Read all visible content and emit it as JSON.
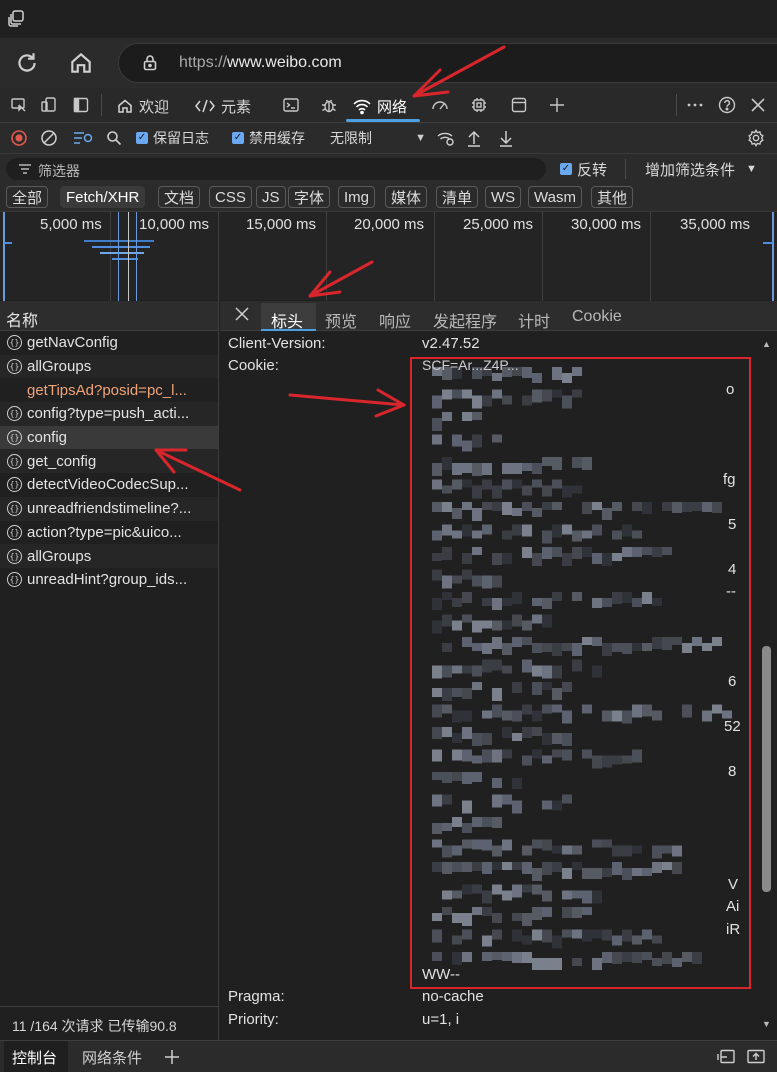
{
  "browser": {
    "url_scheme": "https://",
    "url_host": "www.weibo.com"
  },
  "devtools_tabs": [
    {
      "label": "欢迎"
    },
    {
      "label": "元素"
    },
    {
      "label": "网络"
    }
  ],
  "toolbar": {
    "preserve_log": "保留日志",
    "disable_cache": "禁用缓存",
    "throttling": "无限制"
  },
  "filter": {
    "placeholder": "筛选器",
    "invert": "反转",
    "more_filters": "增加筛选条件"
  },
  "type_filters": [
    "全部",
    "Fetch/XHR",
    "文档",
    "CSS",
    "JS",
    "字体",
    "Img",
    "媒体",
    "清单",
    "WS",
    "Wasm",
    "其他"
  ],
  "timeline_ticks": [
    "5,000 ms",
    "10,000 ms",
    "15,000 ms",
    "20,000 ms",
    "25,000 ms",
    "30,000 ms",
    "35,000 ms"
  ],
  "request_list": {
    "header": "名称",
    "rows": [
      {
        "name": "getNavConfig",
        "type": "xhr"
      },
      {
        "name": "allGroups",
        "type": "xhr"
      },
      {
        "name": "getTipsAd?posid=pc_l...",
        "type": "pending"
      },
      {
        "name": "config?type=push_acti...",
        "type": "xhr"
      },
      {
        "name": "config",
        "type": "xhr"
      },
      {
        "name": "get_config",
        "type": "xhr"
      },
      {
        "name": "detectVideoCodecSup...",
        "type": "xhr"
      },
      {
        "name": "unreadfriendstimeline?...",
        "type": "xhr"
      },
      {
        "name": "action?type=pic&uico...",
        "type": "xhr"
      },
      {
        "name": "allGroups",
        "type": "xhr"
      },
      {
        "name": "unreadHint?group_ids...",
        "type": "xhr"
      }
    ],
    "status": "11 /164 次请求  已传输90.8"
  },
  "detail": {
    "tabs": [
      "标头",
      "预览",
      "响应",
      "发起程序",
      "计时",
      "Cookie"
    ],
    "headers": {
      "client_version_key": "Client-Version:",
      "client_version_val": "v2.47.52",
      "cookie_key": "Cookie:",
      "pragma_key": "Pragma:",
      "pragma_val": "no-cache",
      "priority_key": "Priority:",
      "priority_val": "u=1, i"
    },
    "cookie_visible_fragments": [
      "SCF=Ar...Z4P...",
      "o",
      "fg",
      "5",
      "4",
      "--",
      "6",
      "52",
      "8",
      "V",
      "Ai",
      "iR",
      "WW--"
    ]
  },
  "drawer": {
    "tabs": [
      "控制台",
      "网络条件"
    ]
  },
  "colors": {
    "accent": "#4c9fe0",
    "annotation_red": "#d8262c"
  }
}
